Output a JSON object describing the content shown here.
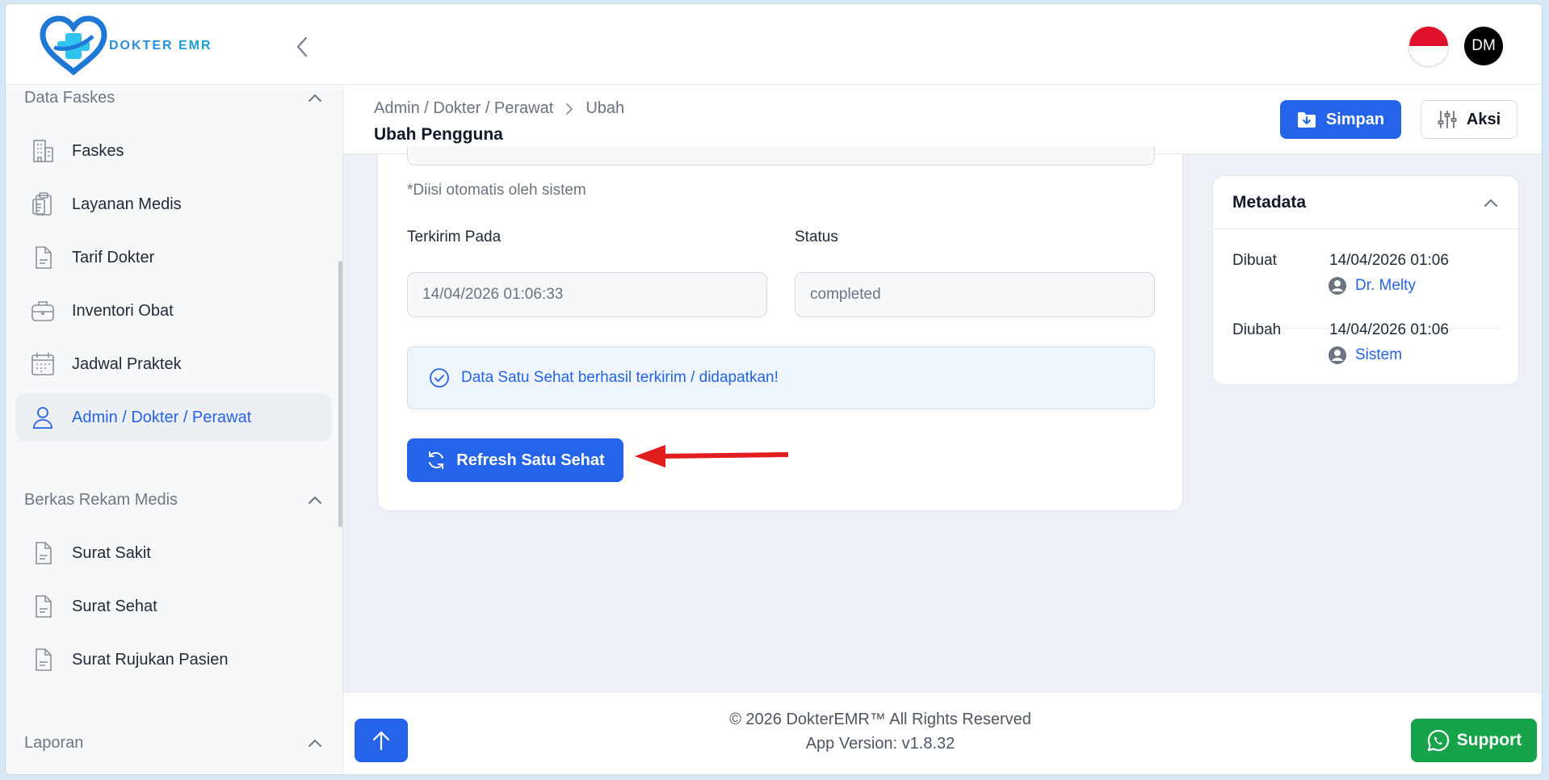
{
  "brand": {
    "name_part1": "DOKTER ",
    "name_part2": "EMR"
  },
  "header": {
    "avatar_initials": "DM"
  },
  "colors": {
    "primary": "#2563eb",
    "support": "#16a34a",
    "brand": "#2a8fdc",
    "flag_red": "#e0122b"
  },
  "sidebar": {
    "sections": [
      {
        "title": "Data Faskes",
        "items": [
          {
            "label": "Faskes",
            "icon": "building-icon"
          },
          {
            "label": "Layanan Medis",
            "icon": "clipboard-icon"
          },
          {
            "label": "Tarif Dokter",
            "icon": "document-icon"
          },
          {
            "label": "Inventori Obat",
            "icon": "briefcase-icon"
          },
          {
            "label": "Jadwal Praktek",
            "icon": "calendar-icon"
          },
          {
            "label": "Admin / Dokter / Perawat",
            "icon": "user-icon",
            "active": true
          }
        ]
      },
      {
        "title": "Berkas Rekam Medis",
        "items": [
          {
            "label": "Surat Sakit",
            "icon": "document-icon"
          },
          {
            "label": "Surat Sehat",
            "icon": "document-icon"
          },
          {
            "label": "Surat Rujukan Pasien",
            "icon": "document-icon"
          }
        ]
      },
      {
        "title": "Laporan",
        "items": []
      }
    ]
  },
  "page": {
    "breadcrumb": [
      "Admin / Dokter / Perawat",
      "Ubah"
    ],
    "title": "Ubah Pengguna",
    "save_label": "Simpan",
    "actions_label": "Aksi"
  },
  "form": {
    "hint": "*Diisi otomatis oleh sistem",
    "sent_at_label": "Terkirim Pada",
    "sent_at_value": "14/04/2026 01:06:33",
    "status_label": "Status",
    "status_value": "completed",
    "alert_text": "Data Satu Sehat berhasil terkirim / didapatkan!",
    "refresh_label": "Refresh Satu Sehat"
  },
  "metadata": {
    "title": "Metadata",
    "created_label": "Dibuat",
    "created_at": "14/04/2026 01:06",
    "created_by": "Dr. Melty",
    "updated_label": "Diubah",
    "updated_at": "14/04/2026 01:06",
    "updated_by": "Sistem"
  },
  "footer": {
    "copyright": "© 2026 DokterEMR™ All Rights Reserved",
    "version": "App Version: v1.8.32",
    "support_label": "Support"
  }
}
